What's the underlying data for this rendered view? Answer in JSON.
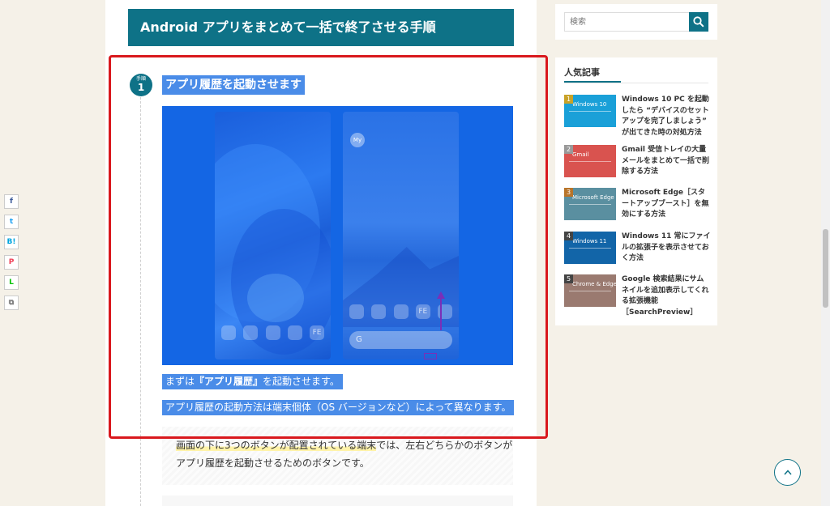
{
  "article": {
    "section_title": "Android アプリをまとめて一括で終了させる手順",
    "step": {
      "badge_small": "手順",
      "badge_num": "1",
      "heading": "アプリ履歴を起動させます"
    },
    "para1_prefix": "まずは",
    "para1_bold": "『アプリ履歴』",
    "para1_suffix": "を起動させます。",
    "para2": "アプリ履歴の起動方法は端末個体（OS バージョンなど）によって異なります。",
    "note_line1_hl": "画面の下に3つのボタンが配置されている端末",
    "note_line1_rest": "では、左右どちらかのボタンが",
    "note_line2": "アプリ履歴を起動させるためのボタンです。",
    "screenshot": {
      "left_label": "FE",
      "right_label": "FE",
      "right_avatar": "My"
    }
  },
  "share": {
    "facebook": "f",
    "twitter": "t",
    "hatena": "B!",
    "pocket": "P",
    "line": "L",
    "copy": "⧉"
  },
  "sidebar": {
    "search_placeholder": "検索",
    "popular_title": "人気記事",
    "items": [
      {
        "rank": "1",
        "title": "Windows 10 PC を起動したら “デバイスのセットアップを完了しましょう” が出てきた時の対処方法",
        "thumb": "Windows 10",
        "color": "#1aa0d8"
      },
      {
        "rank": "2",
        "title": "Gmail 受信トレイの大量メールをまとめて一括で削除する方法",
        "thumb": "Gmail",
        "color": "#d9534f"
      },
      {
        "rank": "3",
        "title": "Microsoft Edge［スタートアップブースト］を無効にする方法",
        "thumb": "Microsoft Edge",
        "color": "#5a8fa0"
      },
      {
        "rank": "4",
        "title": "Windows 11 常にファイルの拡張子を表示させておく方法",
        "thumb": "Windows 11",
        "color": "#1265a8"
      },
      {
        "rank": "5",
        "title": "Google 検索結果にサムネイルを追加表示してくれる拡張機能［SearchPreview］",
        "thumb": "Chrome & Edge",
        "color": "#9a7a70"
      }
    ]
  },
  "colors": {
    "accent": "#0e7287",
    "highlight": "#4a8ce8",
    "frame": "#d9181d"
  }
}
